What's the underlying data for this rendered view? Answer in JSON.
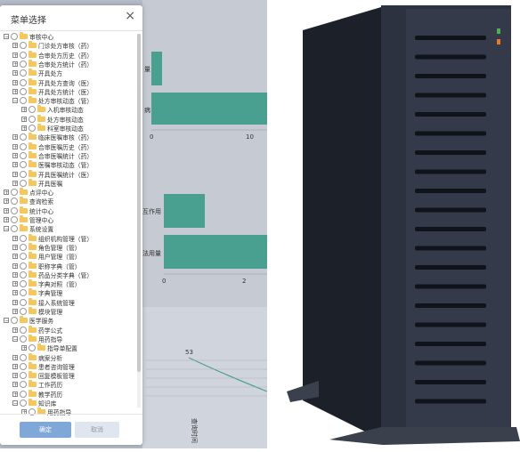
{
  "dialog": {
    "title": "菜单选择",
    "close_symbol": "×",
    "ok_label": "确定",
    "cancel_label": "取消"
  },
  "tree": [
    {
      "label": "审核中心",
      "level": 0,
      "expanded": true
    },
    {
      "label": "门诊处方审核（药）",
      "level": 1
    },
    {
      "label": "合审处方历史（药）",
      "level": 1
    },
    {
      "label": "合审处方统计（药）",
      "level": 1
    },
    {
      "label": "开具处方",
      "level": 1
    },
    {
      "label": "开具处方查询（医）",
      "level": 1
    },
    {
      "label": "开具处方统计（医）",
      "level": 1
    },
    {
      "label": "处方审核动态（管）",
      "level": 1,
      "expanded": true
    },
    {
      "label": "入机审核动态",
      "level": 2
    },
    {
      "label": "处方审核动态",
      "level": 2
    },
    {
      "label": "科室审核动态",
      "level": 2
    },
    {
      "label": "临床医嘱审核（药）",
      "level": 1
    },
    {
      "label": "合审医嘱历史（药）",
      "level": 1
    },
    {
      "label": "合审医嘱统计（药）",
      "level": 1
    },
    {
      "label": "医嘱审核动态（管）",
      "level": 1
    },
    {
      "label": "开具医嘱统计（医）",
      "level": 1
    },
    {
      "label": "开具医嘱",
      "level": 1
    },
    {
      "label": "点评中心",
      "level": 0,
      "expanded": false
    },
    {
      "label": "查询检索",
      "level": 0,
      "expanded": false
    },
    {
      "label": "统计中心",
      "level": 0,
      "expanded": false
    },
    {
      "label": "管理中心",
      "level": 0,
      "expanded": false
    },
    {
      "label": "系统设置",
      "level": 0,
      "expanded": true
    },
    {
      "label": "组织机构管理（管）",
      "level": 1
    },
    {
      "label": "角色管理（管）",
      "level": 1
    },
    {
      "label": "用户管理（管）",
      "level": 1
    },
    {
      "label": "职称字典（管）",
      "level": 1
    },
    {
      "label": "药品分类字典（管）",
      "level": 1
    },
    {
      "label": "字典对照（管）",
      "level": 1
    },
    {
      "label": "字典管理",
      "level": 1
    },
    {
      "label": "接入系统管理",
      "level": 1
    },
    {
      "label": "模块管理",
      "level": 1
    },
    {
      "label": "医学服务",
      "level": 0,
      "expanded": true
    },
    {
      "label": "药学公式",
      "level": 1
    },
    {
      "label": "用药指导",
      "level": 1,
      "expanded": true
    },
    {
      "label": "指导单配置",
      "level": 2
    },
    {
      "label": "病案分析",
      "level": 1
    },
    {
      "label": "患者咨询管理",
      "level": 1
    },
    {
      "label": "回复模板管理",
      "level": 1
    },
    {
      "label": "工作药历",
      "level": 1
    },
    {
      "label": "教学药历",
      "level": 1
    },
    {
      "label": "知识库",
      "level": 1,
      "expanded": true
    },
    {
      "label": "用药指导",
      "level": 2
    }
  ],
  "background": {
    "chart1_labels": [
      "量",
      "病"
    ],
    "chart1_ticks": [
      "0",
      "10"
    ],
    "chart2_labels": [
      "互作用",
      "法用量"
    ],
    "chart2_ticks": [
      "0",
      "2"
    ],
    "chart3_point_label": "53",
    "chart3_axis_label": "查询时间"
  },
  "colors": {
    "bar": "#4aa090",
    "overlay": "#b5bcc8",
    "ok_button": "#7fa7d8",
    "server_body": "#2d3240"
  }
}
